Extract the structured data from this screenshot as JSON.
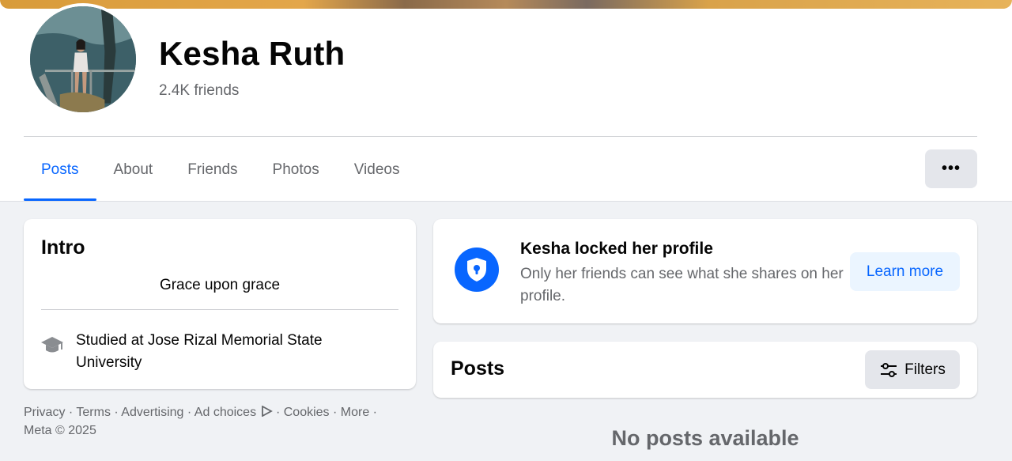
{
  "profile": {
    "name": "Kesha Ruth",
    "friends_count": "2.4K friends",
    "avatar_icon": "profile-photo"
  },
  "tabs": [
    {
      "label": "Posts",
      "active": true
    },
    {
      "label": "About",
      "active": false
    },
    {
      "label": "Friends",
      "active": false
    },
    {
      "label": "Photos",
      "active": false
    },
    {
      "label": "Videos",
      "active": false
    }
  ],
  "more_button": {
    "label": "•••",
    "icon": "more-horizontal-icon"
  },
  "intro": {
    "title": "Intro",
    "bio": "Grace upon grace",
    "education": "Studied at Jose Rizal Memorial State University",
    "education_icon": "graduation-cap-icon"
  },
  "footer": {
    "links": [
      "Privacy",
      "Terms",
      "Advertising",
      "Ad choices",
      "Cookies",
      "More"
    ],
    "separator": " · ",
    "copyright": "Meta © 2025"
  },
  "locked_notice": {
    "title": "Kesha locked her profile",
    "description": "Only her friends can see what she shares on her profile.",
    "button_label": "Learn more",
    "icon": "shield-lock-icon"
  },
  "posts": {
    "title": "Posts",
    "filters_label": "Filters",
    "filters_icon": "sliders-icon",
    "empty_message": "No posts available"
  },
  "colors": {
    "accent": "#0866ff",
    "page_bg": "#f0f2f5",
    "secondary_text": "#65676b",
    "button_gray": "#e4e6eb",
    "learn_more_bg": "#ebf5ff"
  }
}
